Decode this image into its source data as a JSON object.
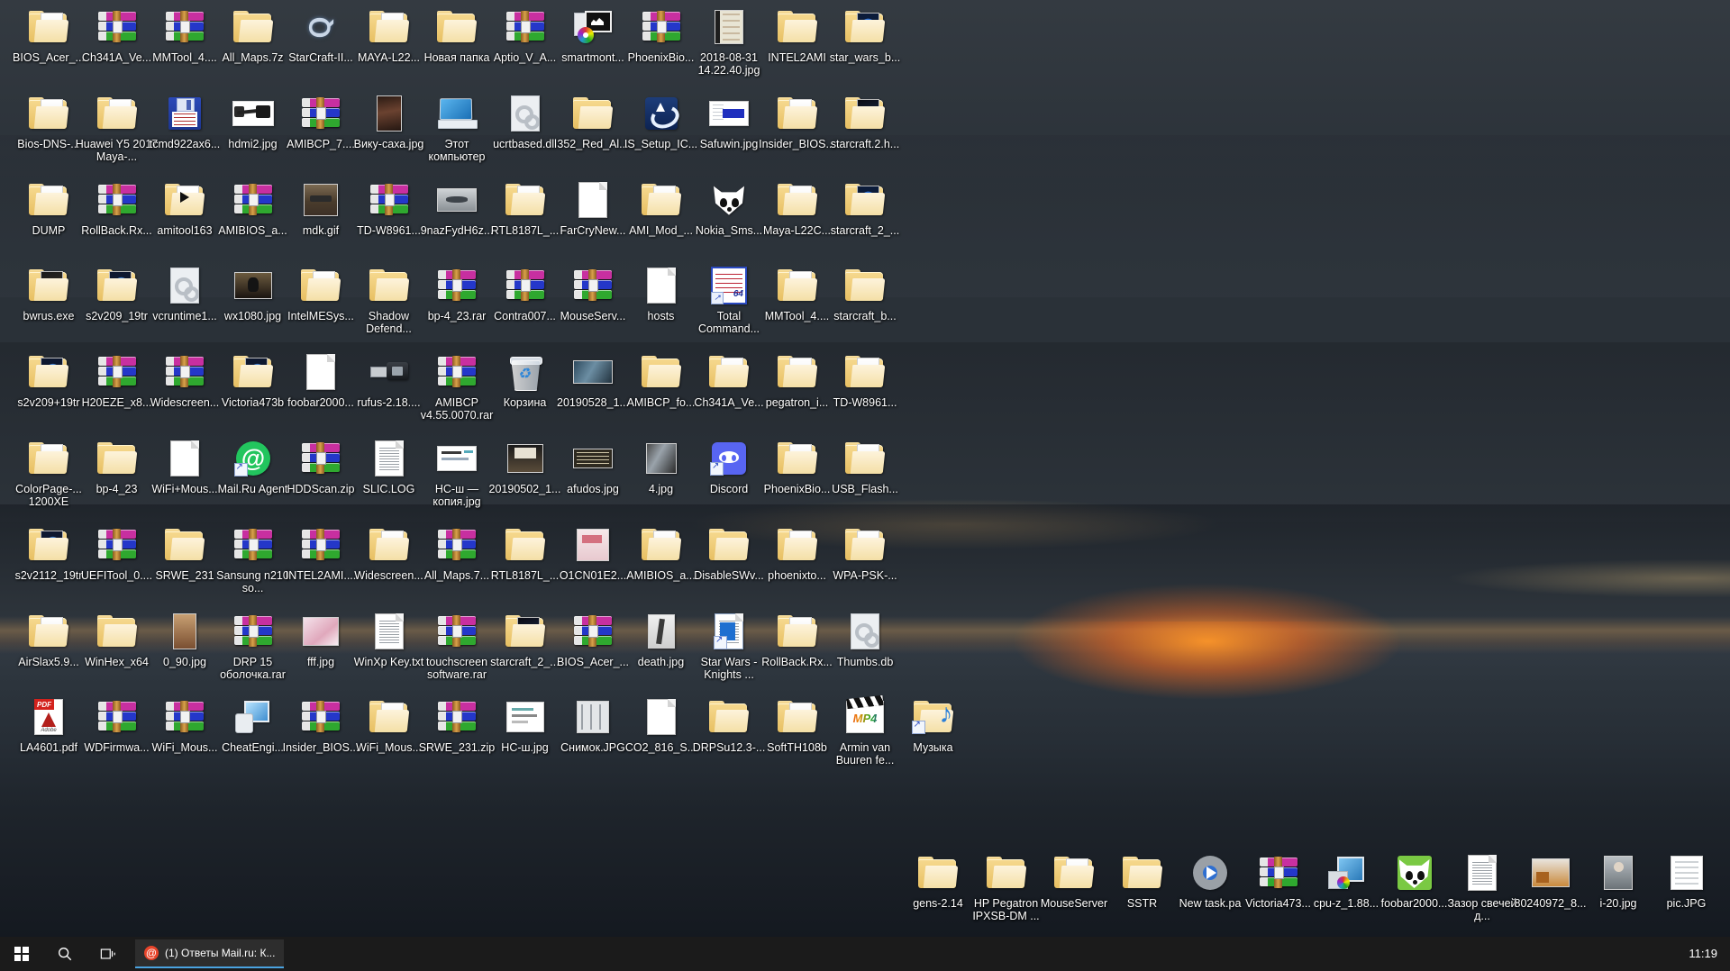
{
  "desktop": {
    "grid": {
      "col_x": [
        4,
        66,
        128,
        190,
        252,
        314,
        376,
        438,
        500,
        562,
        624,
        686,
        748,
        810,
        872,
        934
      ],
      "note": "16 icon columns; positions computed in template"
    },
    "icons_left": [
      [
        {
          "label": "BIOS_Acer_...",
          "art": "folder"
        },
        {
          "label": "Ch341A_Ve...",
          "art": "rar"
        },
        {
          "label": "MMTool_4....",
          "art": "rar"
        },
        {
          "label": "All_Maps.7z",
          "art": "folder-plain"
        },
        {
          "label": "StarCraft-II...",
          "art": "starcraft"
        },
        {
          "label": "MAYA-L22...",
          "art": "folder"
        },
        {
          "label": "Новая папка",
          "art": "folder-plain"
        },
        {
          "label": "Aptio_V_A...",
          "art": "rar"
        },
        {
          "label": "smartmont...",
          "art": "smart"
        },
        {
          "label": "PhoenixBio...",
          "art": "rar"
        },
        {
          "label": "2018-08-31 14.22.40.jpg",
          "art": "img-doc"
        },
        {
          "label": "INTEL2AMI",
          "art": "folder-plain"
        },
        {
          "label": "star_wars_b...",
          "art": "folder-img-sw"
        }
      ],
      [
        {
          "label": "Bios-DNS-...",
          "art": "folder"
        },
        {
          "label": "Huawei Y5 2017 Maya-...",
          "art": "folder"
        },
        {
          "label": "tcmd922ax6...",
          "art": "floppy"
        },
        {
          "label": "hdmi2.jpg",
          "art": "hdmi"
        },
        {
          "label": "AMIBCP_7....",
          "art": "rar"
        },
        {
          "label": "Вику-саха.jpg",
          "art": "img-girl"
        },
        {
          "label": "Этот компьютер",
          "art": "monitor"
        },
        {
          "label": "ucrtbased.dll",
          "art": "cfg"
        },
        {
          "label": "352_Red_Al...",
          "art": "folder-plain"
        },
        {
          "label": "IS_Setup_IC...",
          "art": "isicon"
        },
        {
          "label": "Safuwin.jpg",
          "art": "safuwin"
        },
        {
          "label": "Insider_BIOS...",
          "art": "folder"
        },
        {
          "label": "starcraft.2.h...",
          "art": "folder-img-sc"
        }
      ],
      [
        {
          "label": "DUMP",
          "art": "folder"
        },
        {
          "label": "RollBack.Rx...",
          "art": "rar"
        },
        {
          "label": "amitool163",
          "art": "folder-play"
        },
        {
          "label": "AMIBIOS_a...",
          "art": "rar"
        },
        {
          "label": "mdk.gif",
          "art": "img-mdk"
        },
        {
          "label": "TD-W8961...",
          "art": "rar"
        },
        {
          "label": "9nazFydH6z...",
          "art": "img-plane"
        },
        {
          "label": "RTL8187L_...",
          "art": "folder"
        },
        {
          "label": "FarCryNew...",
          "art": "doc"
        },
        {
          "label": "AMI_Mod_...",
          "art": "folder"
        },
        {
          "label": "Nokia_Sms...",
          "art": "foobar"
        },
        {
          "label": "Maya-L22C...",
          "art": "folder"
        },
        {
          "label": "starcraft_2_...",
          "art": "folder-img-sw"
        }
      ],
      [
        {
          "label": "bwrus.exe",
          "art": "folder-img-dark"
        },
        {
          "label": "s2v209_19tr",
          "art": "folder-img-blue"
        },
        {
          "label": "vcruntime1...",
          "art": "cfg"
        },
        {
          "label": "wx1080.jpg",
          "art": "img-wx"
        },
        {
          "label": "IntelMESys...",
          "art": "folder"
        },
        {
          "label": "Shadow Defend...",
          "art": "folder-plain"
        },
        {
          "label": "bp-4_23.rar",
          "art": "rar"
        },
        {
          "label": "Contra007...",
          "art": "rar"
        },
        {
          "label": "MouseServ...",
          "art": "rar"
        },
        {
          "label": "hosts",
          "art": "doc"
        },
        {
          "label": "Total Command...",
          "art": "tc"
        },
        {
          "label": "MMTool_4....",
          "art": "folder"
        },
        {
          "label": "starcraft_b...",
          "art": "folder-plain"
        }
      ],
      [
        {
          "label": "s2v209+19tr",
          "art": "folder-img-blue"
        },
        {
          "label": "H20EZE_x8...",
          "art": "rar"
        },
        {
          "label": "Widescreen...",
          "art": "rar"
        },
        {
          "label": "Victoria473b",
          "art": "folder-img-blue"
        },
        {
          "label": "foobar2000...",
          "art": "doc"
        },
        {
          "label": "rufus-2.18....",
          "art": "usb"
        },
        {
          "label": "AMIBCP v4.55.0070.rar",
          "art": "rar"
        },
        {
          "label": "Корзина",
          "art": "recycle"
        },
        {
          "label": "20190528_1...",
          "art": "img-board"
        },
        {
          "label": "AMIBCP_fo...",
          "art": "folder-plain"
        },
        {
          "label": "Ch341A_Ve...",
          "art": "folder"
        },
        {
          "label": "pegatron_i...",
          "art": "folder"
        },
        {
          "label": "TD-W8961...",
          "art": "folder"
        }
      ],
      [
        {
          "label": "ColorPage-... 1200XE",
          "art": "folder"
        },
        {
          "label": "bp-4_23",
          "art": "folder-plain"
        },
        {
          "label": "WiFi+Mous...",
          "art": "doc"
        },
        {
          "label": "Mail.Ru Agent",
          "art": "mailru"
        },
        {
          "label": "HDDScan.zip",
          "art": "rar"
        },
        {
          "label": "SLIC.LOG",
          "art": "doc-lines"
        },
        {
          "label": "НС-ш — копия.jpg",
          "art": "img-doc2"
        },
        {
          "label": "20190502_1...",
          "art": "img-dark2"
        },
        {
          "label": "afudos.jpg",
          "art": "img-text"
        },
        {
          "label": "4.jpg",
          "art": "img-board2"
        },
        {
          "label": "Discord",
          "art": "discord"
        },
        {
          "label": "PhoenixBio...",
          "art": "folder"
        },
        {
          "label": "USB_Flash...",
          "art": "folder"
        }
      ],
      [
        {
          "label": "s2v2112_19tr",
          "art": "folder-img-blue"
        },
        {
          "label": "UEFITool_0....",
          "art": "rar"
        },
        {
          "label": "SRWE_231",
          "art": "folder-plain"
        },
        {
          "label": "Sansung n210 so...",
          "art": "rar"
        },
        {
          "label": "INTEL2AMI....",
          "art": "rar"
        },
        {
          "label": "Widescreen...",
          "art": "folder"
        },
        {
          "label": "All_Maps.7...",
          "art": "rar"
        },
        {
          "label": "RTL8187L_...",
          "art": "folder-plain"
        },
        {
          "label": "O1CN01E2...",
          "art": "img-pink"
        },
        {
          "label": "AMIBIOS_a...",
          "art": "folder"
        },
        {
          "label": "DisableSWv...",
          "art": "folder-plain"
        },
        {
          "label": "phoenixto...",
          "art": "folder"
        },
        {
          "label": "WPA-PSK-...",
          "art": "folder"
        }
      ],
      [
        {
          "label": "AirSlax5.9...",
          "art": "folder"
        },
        {
          "label": "WinHex_x64",
          "art": "folder-plain"
        },
        {
          "label": "0_90.jpg",
          "art": "img-face"
        },
        {
          "label": "DRP 15 оболочка.rar",
          "art": "rar"
        },
        {
          "label": "fff.jpg",
          "art": "img-pink2"
        },
        {
          "label": "WinXp Key.txt",
          "art": "doc-lines"
        },
        {
          "label": "touchscreen software.rar",
          "art": "rar"
        },
        {
          "label": "starcraft_2_...",
          "art": "folder-img-sc"
        },
        {
          "label": "BIOS_Acer_...",
          "art": "rar"
        },
        {
          "label": "death.jpg",
          "art": "img-death"
        },
        {
          "label": "Star Wars - Knights ...",
          "art": "sw-blue"
        },
        {
          "label": "RollBack.Rx...",
          "art": "folder"
        },
        {
          "label": "Thumbs.db",
          "art": "cfg"
        }
      ],
      [
        {
          "label": "LA4601.pdf",
          "art": "pdf"
        },
        {
          "label": "WDFirmwa...",
          "art": "rar"
        },
        {
          "label": "WiFi_Mous...",
          "art": "rar"
        },
        {
          "label": "CheatEngi...",
          "art": "cheat"
        },
        {
          "label": "Insider_BIOS...",
          "art": "rar"
        },
        {
          "label": "WiFi_Mous...",
          "art": "folder"
        },
        {
          "label": "SRWE_231.zip",
          "art": "rar"
        },
        {
          "label": "НС-ш.jpg",
          "art": "img-doc3"
        },
        {
          "label": "Снимок.JPG",
          "art": "img-gray"
        },
        {
          "label": "CO2_816_S...",
          "art": "doc"
        },
        {
          "label": "DRPSu12.3-...",
          "art": "folder-plain"
        },
        {
          "label": "SoftTH108b",
          "art": "folder"
        },
        {
          "label": "Armin van Buuren fe...",
          "art": "mp4"
        },
        {
          "label": "Музыка",
          "art": "music"
        }
      ]
    ],
    "icons_bottom": [
      {
        "label": "gens-2.14",
        "art": "folder-plain"
      },
      {
        "label": "HP Pegatron IPXSB-DM ...",
        "art": "folder-plain"
      },
      {
        "label": "MouseServer",
        "art": "folder"
      },
      {
        "label": "SSTR",
        "art": "folder-plain"
      },
      {
        "label": "New task.pa",
        "art": "gear"
      },
      {
        "label": "Victoria473...",
        "art": "rar"
      },
      {
        "label": "cpu-z_1.88...",
        "art": "cpuz"
      },
      {
        "label": "foobar2000...",
        "art": "foobar-green"
      },
      {
        "label": "Зазор свечей д...",
        "art": "doc-lines"
      },
      {
        "label": "80240972_8...",
        "art": "img-orange"
      },
      {
        "label": "i-20.jpg",
        "art": "img-person"
      },
      {
        "label": "pic.JPG",
        "art": "img-doc4"
      }
    ]
  },
  "taskbar": {
    "start_label": "Start",
    "search_icon": "search-icon",
    "taskview_icon": "task-view-icon",
    "task_button_label": "(1) Ответы Mail.ru: К...",
    "clock_time": "11:19",
    "accent_color": "#4aa3e0",
    "background_color": "#1b1b1b"
  }
}
